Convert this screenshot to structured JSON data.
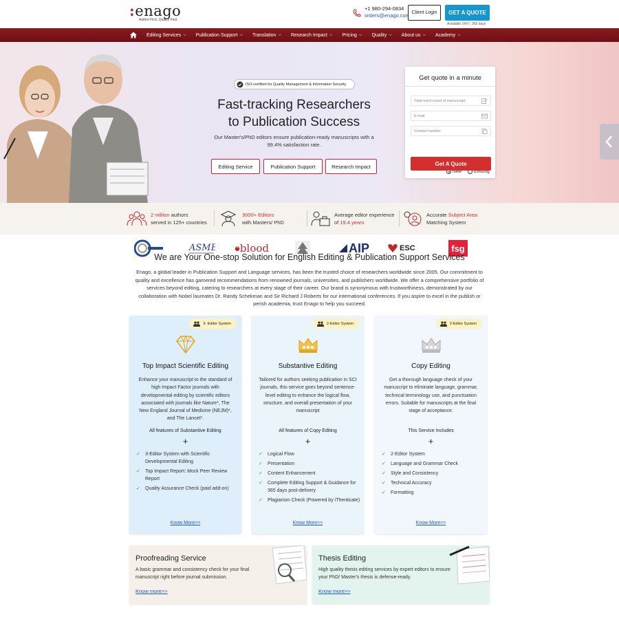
{
  "header": {
    "logo_text": "enago",
    "logo_tagline": "Author First, Quality First",
    "phone": "+1 980-294-0834",
    "email": "orders@enago.com",
    "client_login": "Client Login",
    "get_quote": "GET A QUOTE",
    "availability": "Available 24X7, 365 days"
  },
  "nav": {
    "items": [
      {
        "label": "Editing Services"
      },
      {
        "label": "Publication Support"
      },
      {
        "label": "Translation"
      },
      {
        "label": "Research Impact"
      },
      {
        "label": "Pricing"
      },
      {
        "label": "Quality"
      },
      {
        "label": "About us"
      },
      {
        "label": "Academy"
      }
    ]
  },
  "hero": {
    "iso": "ISO-certified for Quality Management & Information Security",
    "title_line1": "Fast-tracking Researchers",
    "title_line2": "to Publication Success",
    "subtitle": "Our Master's/PhD editors ensure publication-ready manuscripts with a 99.4% satisfaction rate.",
    "buttons": [
      "Editing Service",
      "Publication Support",
      "Research Impact"
    ]
  },
  "quote_form": {
    "title": "Get quote in a minute",
    "word_count_placeholder": "Total word count of manuscript",
    "email_placeholder": "E-mail",
    "contact_placeholder": "Contact number",
    "radio_new": "New",
    "radio_existing": "Existing",
    "selected": "New",
    "submit": "Get A Quote"
  },
  "stats": [
    {
      "hl": "2 million",
      "text1": " authors",
      "text2": "served in 125+ countries"
    },
    {
      "hl": "3000+ Editors",
      "text1": "",
      "text2": "with Masters/ PhD"
    },
    {
      "pre": "Average editor experience",
      "text1": "of ",
      "hl": "19.4 years"
    },
    {
      "pre": "Accurate ",
      "hl": "Subject Area",
      "text2": "Matching System"
    }
  ],
  "partner_logos": [
    {
      "label": "blood"
    },
    {
      "label": "AIP"
    },
    {
      "label": "ESC"
    },
    {
      "label": "fsg"
    }
  ],
  "intro": {
    "title": "We are Your One-stop Solution for English Editing & Publication Support Services",
    "body": "Enago, a global leader in Publication Support and Language services, has been the trusted choice of researchers worldwide since 2005. Our commitment to quality and excellence has garnered recommendations from renowned journals, universities, and publishers worldwide. We offer a comprehensive portfolio of services beyond editing, catering to researchers at every stage of their career. Our brand is synonymous with trustworthiness, demonstrated by our collaboration with Nobel laureates Dr. Randy Schekman and Sir Richard J Roberts for our international conferences. If you aspire to excel in the publish or perish academia, trust Enago to help you succeed."
  },
  "cards": [
    {
      "badge": "3- Editor System",
      "title": "Top Impact Scientific Editing",
      "desc": "Enhance your manuscript to the standard of high Impact Factor journals with developmental editing by scientific editors associated with journals like Nature*, The New England Journal of Medicine (NEJM)*, and The Lancet*.",
      "sub": "All features of Substantive Editing",
      "features": [
        "3-Editor System with Scientific Developmental Editing",
        "Top Impact Report: Mock Peer Review Report",
        "Quality Assurance Check (paid add-on)"
      ],
      "link": "Know More>>"
    },
    {
      "badge": "2-Editor System",
      "title": "Substantive Editing",
      "desc": "Tailored for authors seeking publication in SCI journals, this service goes beyond sentence-level editing to enhance the logical flow, structure, and overall presentation of your manuscript",
      "sub": "All features of Copy Editing",
      "features": [
        "Logical Flow",
        "Presentation",
        "Content Enhancement",
        "Complete Editing Support & Guidance for 365 days post-delivery",
        "Plagiarism Check (Powered by iThenticate)"
      ],
      "link": "Know More>>"
    },
    {
      "badge": "2-Editor System",
      "title": "Copy Editing",
      "desc": "Get a thorough language check of your manuscript to eliminate language, grammar, technical terminology use, and punctuation errors. Suitable for manuscripts at the final stage of acceptance.",
      "sub": "This Service Includes",
      "features": [
        "2-Editor System",
        "Language and Grammar Check",
        "Style and Consistency",
        "Technical Accuracy",
        "Formatting"
      ],
      "link": "Know More>>"
    }
  ],
  "bottom_cards": [
    {
      "title": "Proofreading Service",
      "desc": "A basic grammar and consistency check for your final manuscript right before journal submission.",
      "link": "Know more>>",
      "bg": "#f5f0ea"
    },
    {
      "title": "Thesis Editing",
      "desc": "High quality thesis editing services by expert editors to ensure your PhD/ Master's thesis is defense-ready.",
      "link": "Know more>>",
      "bg": "#e3f4ee"
    }
  ],
  "colors": {
    "brand_red": "#c0282d",
    "nav_bg": "#7a1519",
    "quote_blue": "#1596d1",
    "link_blue": "#1f57c7"
  }
}
